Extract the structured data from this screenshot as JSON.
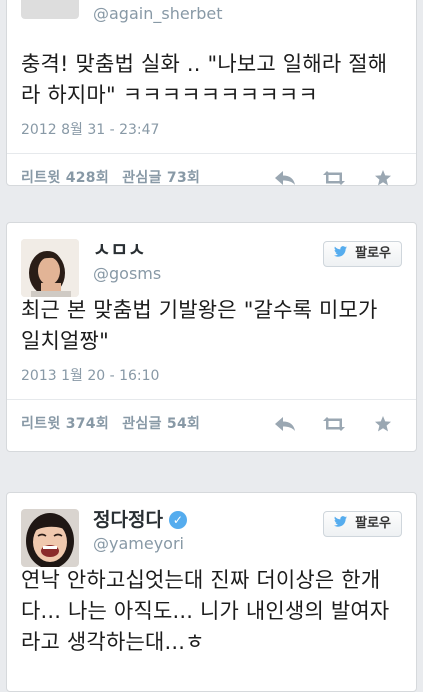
{
  "tweets": [
    {
      "name": "",
      "handle": "@again_sherbet",
      "text": "충격! 맞춤법 실화 .. \"나보고 일해라 절해라 하지마\" ㅋㅋㅋㅋㅋㅋㅋㅋㅋㅋ",
      "date": "2012 8월 31 - 23:47",
      "retweets": "리트윗 428회",
      "likes": "관심글 73회",
      "follow_label": ""
    },
    {
      "name": "ㅅㅁㅅ",
      "handle": "@gosms",
      "text": "최근 본 맞춤법 기발왕은 \"갈수록 미모가 일치얼짱\"",
      "date": "2013 1월 20 - 16:10",
      "retweets": "리트윗 374회",
      "likes": "관심글 54회",
      "follow_label": "팔로우"
    },
    {
      "name": "정다정다",
      "handle": "@yameyori",
      "text": "연낙 안하고십엇는대 진짜 더이상은 한개다... 나는 아직도... 니가 내인생의 발여자라고 생각하는대...ㅎ",
      "date": "",
      "retweets": "",
      "likes": "",
      "follow_label": "팔로우"
    }
  ],
  "icons": {
    "reply": "reply-icon",
    "retweet": "retweet-icon",
    "favorite": "star-icon",
    "follow_bird": "twitter-bird-icon",
    "verified": "verified-badge-icon"
  },
  "colors": {
    "accent": "#55acee",
    "muted": "#8899a6",
    "background": "#e9ebee"
  }
}
